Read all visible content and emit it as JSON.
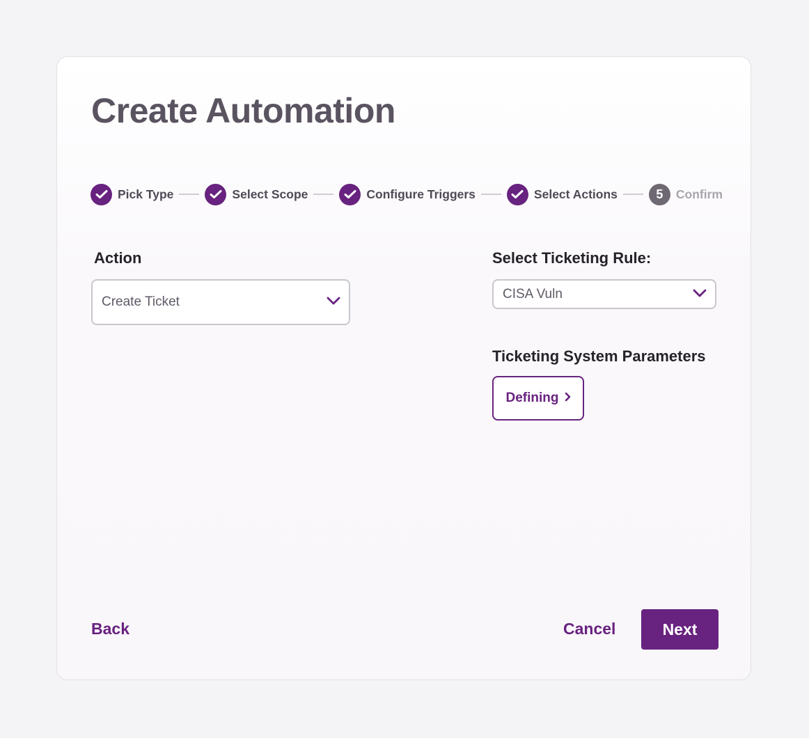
{
  "page": {
    "title": "Create Automation"
  },
  "stepper": {
    "steps": [
      {
        "label": "Pick Type",
        "status": "complete"
      },
      {
        "label": "Select Scope",
        "status": "complete"
      },
      {
        "label": "Configure Triggers",
        "status": "complete"
      },
      {
        "label": "Select Actions",
        "status": "complete"
      },
      {
        "label": "Confirm",
        "status": "pending",
        "number": "5"
      }
    ]
  },
  "action": {
    "label": "Action",
    "value": "Create Ticket"
  },
  "ticketing_rule": {
    "label": "Select Ticketing Rule:",
    "value": "CISA Vuln"
  },
  "ticketing_params": {
    "label": "Ticketing System Parameters",
    "button_label": "Defining"
  },
  "footer": {
    "back_label": "Back",
    "cancel_label": "Cancel",
    "next_label": "Next"
  },
  "colors": {
    "brand": "#68227f",
    "pending_step": "#6e6873",
    "background": "#f4f4f6"
  },
  "icons": {
    "complete_step": "check-icon",
    "dropdown": "chevron-down-icon",
    "define": "chevron-right-icon"
  }
}
